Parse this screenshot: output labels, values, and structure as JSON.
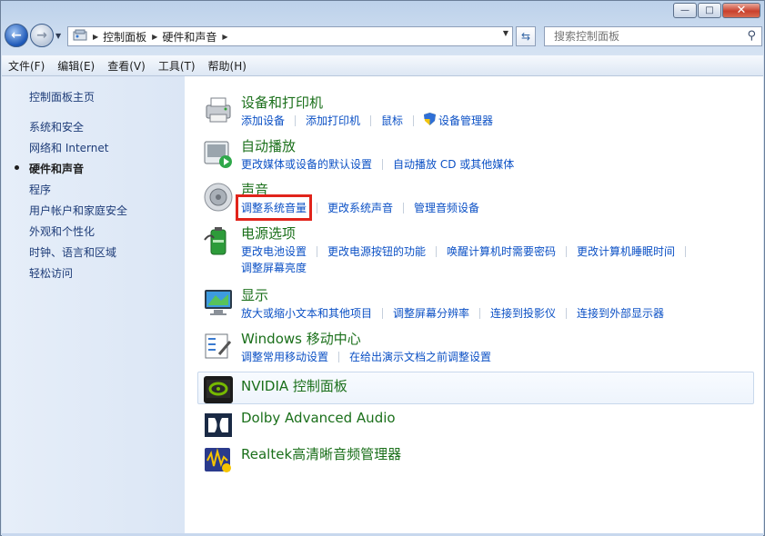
{
  "window": {
    "caption_min": "—",
    "caption_max": "□",
    "caption_close": "✕"
  },
  "address": {
    "crumbs": [
      "控制面板",
      "硬件和声音"
    ]
  },
  "search": {
    "placeholder": "搜索控制面板"
  },
  "menu": [
    "文件(F)",
    "编辑(E)",
    "查看(V)",
    "工具(T)",
    "帮助(H)"
  ],
  "sidebar": {
    "home": "控制面板主页",
    "items": [
      "系统和安全",
      "网络和 Internet",
      "硬件和声音",
      "程序",
      "用户帐户和家庭安全",
      "外观和个性化",
      "时钟、语言和区域",
      "轻松访问"
    ],
    "current_index": 2
  },
  "sections": [
    {
      "title": "设备和打印机",
      "links": [
        "添加设备",
        "添加打印机",
        "鼠标",
        "设备管理器"
      ]
    },
    {
      "title": "自动播放",
      "links": [
        "更改媒体或设备的默认设置",
        "自动播放 CD 或其他媒体"
      ]
    },
    {
      "title": "声音",
      "links": [
        "调整系统音量",
        "更改系统声音",
        "管理音频设备"
      ]
    },
    {
      "title": "电源选项",
      "links": [
        "更改电池设置",
        "更改电源按钮的功能",
        "唤醒计算机时需要密码",
        "更改计算机睡眠时间"
      ],
      "links2": [
        "调整屏幕亮度"
      ]
    },
    {
      "title": "显示",
      "links": [
        "放大或缩小文本和其他项目",
        "调整屏幕分辨率",
        "连接到投影仪",
        "连接到外部显示器"
      ]
    },
    {
      "title": "Windows 移动中心",
      "links": [
        "调整常用移动设置",
        "在给出演示文档之前调整设置"
      ]
    },
    {
      "title": "NVIDIA 控制面板",
      "links": []
    },
    {
      "title": "Dolby Advanced Audio",
      "links": []
    },
    {
      "title": "Realtek高清晰音频管理器",
      "links": []
    }
  ],
  "colors": {
    "link": "#0b50c5",
    "title": "#1a6f1a",
    "highlight": "#e1241b"
  }
}
